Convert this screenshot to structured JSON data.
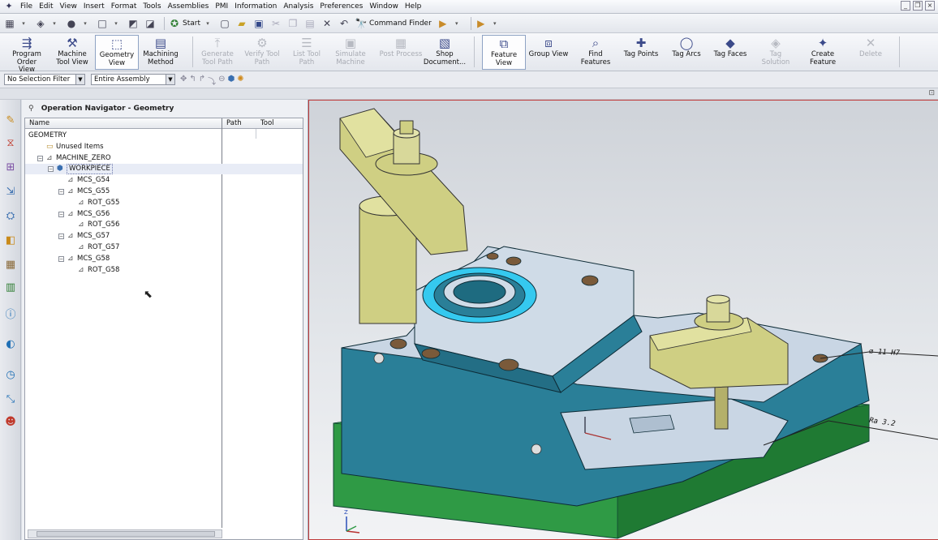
{
  "menu": [
    "File",
    "Edit",
    "View",
    "Insert",
    "Format",
    "Tools",
    "Assemblies",
    "PMI",
    "Information",
    "Analysis",
    "Preferences",
    "Window",
    "Help"
  ],
  "window_controls": [
    "_",
    "❐",
    "×"
  ],
  "quick_access": {
    "start_label": "Start",
    "command_finder_label": "Command Finder"
  },
  "ribbon": [
    {
      "label": "Program\nOrder View",
      "icon": "program-order-icon",
      "enabled": true
    },
    {
      "label": "Machine\nTool View",
      "icon": "machine-tool-icon",
      "enabled": true
    },
    {
      "label": "Geometry\nView",
      "icon": "geometry-view-icon",
      "enabled": true,
      "selected": true
    },
    {
      "label": "Machining\nMethod",
      "icon": "machining-method-icon",
      "enabled": true
    },
    {
      "label": "Generate\nTool Path",
      "icon": "generate-tool-path-icon",
      "enabled": false
    },
    {
      "label": "Verify Tool\nPath",
      "icon": "verify-tool-path-icon",
      "enabled": false
    },
    {
      "label": "List Tool\nPath",
      "icon": "list-tool-path-icon",
      "enabled": false
    },
    {
      "label": "Simulate\nMachine",
      "icon": "simulate-machine-icon",
      "enabled": false
    },
    {
      "label": "Post Process",
      "icon": "post-process-icon",
      "enabled": false
    },
    {
      "label": "Shop\nDocument...",
      "icon": "shop-document-icon",
      "enabled": true
    },
    {
      "label": "Feature\nView",
      "icon": "feature-view-icon",
      "enabled": true,
      "selected": true
    },
    {
      "label": "Group View",
      "icon": "group-view-icon",
      "enabled": true
    },
    {
      "label": "Find\nFeatures",
      "icon": "find-features-icon",
      "enabled": true
    },
    {
      "label": "Tag Points",
      "icon": "tag-points-icon",
      "enabled": true
    },
    {
      "label": "Tag Arcs",
      "icon": "tag-arcs-icon",
      "enabled": true
    },
    {
      "label": "Tag Faces",
      "icon": "tag-faces-icon",
      "enabled": true
    },
    {
      "label": "Tag\nSolution",
      "icon": "tag-solution-icon",
      "enabled": false
    },
    {
      "label": "Create\nFeature",
      "icon": "create-feature-icon",
      "enabled": true
    },
    {
      "label": "Delete",
      "icon": "delete-icon",
      "enabled": false
    }
  ],
  "filters": {
    "selection_filter": "No Selection Filter",
    "scope": "Entire Assembly"
  },
  "navigator": {
    "title": "Operation Navigator - Geometry",
    "columns": [
      "Name",
      "Path",
      "Tool"
    ],
    "rows": [
      {
        "name": "GEOMETRY",
        "level": 0,
        "toggle": "",
        "icon": ""
      },
      {
        "name": "Unused Items",
        "level": 1,
        "toggle": "",
        "icon": "folder-icon"
      },
      {
        "name": "MACHINE_ZERO",
        "level": 1,
        "toggle": "−",
        "icon": "mcs-icon"
      },
      {
        "name": "WORKPIECE",
        "level": 2,
        "toggle": "−",
        "icon": "workpiece-icon",
        "highlighted": true
      },
      {
        "name": "MCS_G54",
        "level": 3,
        "toggle": "",
        "icon": "mcs-icon"
      },
      {
        "name": "MCS_G55",
        "level": 3,
        "toggle": "−",
        "icon": "mcs-icon"
      },
      {
        "name": "ROT_G55",
        "level": 4,
        "toggle": "",
        "icon": "mcs-icon"
      },
      {
        "name": "MCS_G56",
        "level": 3,
        "toggle": "−",
        "icon": "mcs-icon"
      },
      {
        "name": "ROT_G56",
        "level": 4,
        "toggle": "",
        "icon": "mcs-icon"
      },
      {
        "name": "MCS_G57",
        "level": 3,
        "toggle": "−",
        "icon": "mcs-icon"
      },
      {
        "name": "ROT_G57",
        "level": 4,
        "toggle": "",
        "icon": "mcs-icon"
      },
      {
        "name": "MCS_G58",
        "level": 3,
        "toggle": "−",
        "icon": "mcs-icon"
      },
      {
        "name": "ROT_G58",
        "level": 4,
        "toggle": "",
        "icon": "mcs-icon"
      }
    ]
  },
  "annotations": {
    "hole_callout": "⌀ 11 H7",
    "roughness": "Ra 3.2"
  },
  "triad": {
    "z": "Z"
  },
  "colors": {
    "fixture_blue": "#2a7f98",
    "fixture_top": "#c9d6e4",
    "base_green": "#2f9a45",
    "clamp_yellow": "#cfcf83",
    "highlight_cyan": "#35c9ef",
    "viewport_border": "#c03a3a"
  }
}
